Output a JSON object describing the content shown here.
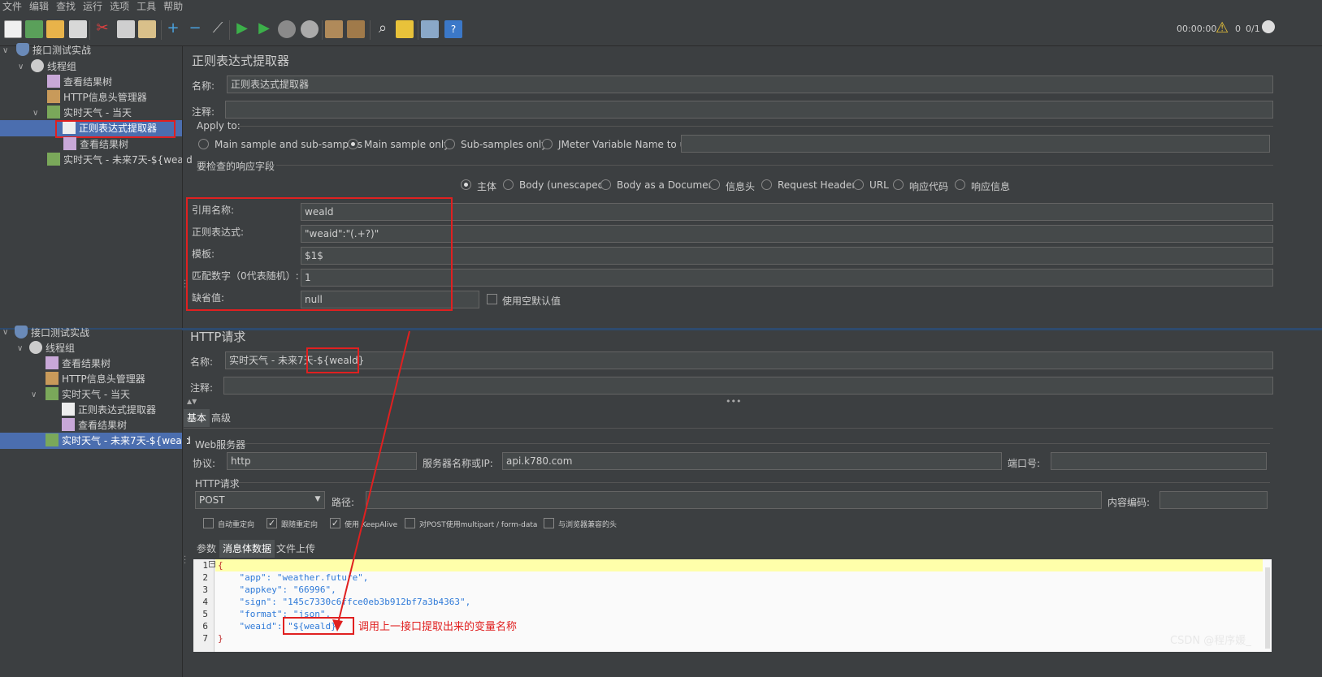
{
  "menu": [
    "文件",
    "编辑",
    "查找",
    "运行",
    "选项",
    "工具",
    "帮助"
  ],
  "status": {
    "time": "00:00:00",
    "warnings": "0",
    "threads": "0/1"
  },
  "tree": {
    "plan": "接口测试实战",
    "group": "线程组",
    "result_tree": "查看结果树",
    "header_mgr": "HTTP信息头管理器",
    "req_today": "实时天气 - 当天",
    "extractor": "正则表达式提取器",
    "result_tree2": "查看结果树",
    "req_7days": "实时天气 - 未来7天-${weald"
  },
  "extractor_panel": {
    "title": "正则表达式提取器",
    "name_label": "名称:",
    "name_value": "正则表达式提取器",
    "comment_label": "注释:",
    "apply_to": "Apply to:",
    "apply_options": [
      "Main sample and sub-samples",
      "Main sample only",
      "Sub-samples only",
      "JMeter Variable Name to use"
    ],
    "field_check": "要检查的响应字段",
    "field_options": [
      "主体",
      "Body (unescaped)",
      "Body as a Document",
      "信息头",
      "Request Headers",
      "URL",
      "响应代码",
      "响应信息"
    ],
    "ref_name_label": "引用名称:",
    "ref_name_value": "weald",
    "regex_label": "正则表达式:",
    "regex_value": "\"weaid\":\"(.+?)\"",
    "template_label": "模板:",
    "template_value": "$1$",
    "match_label": "匹配数字（0代表随机）:",
    "match_value": "1",
    "default_label": "缺省值:",
    "default_value": "null",
    "use_empty": "使用空默认值"
  },
  "http_panel": {
    "title": "HTTP请求",
    "name_label": "名称:",
    "name_prefix": "实时天气 - 未来7天-",
    "name_var": "${weald}",
    "comment_label": "注释:",
    "tab_basic": "基本",
    "tab_advanced": "高级",
    "web_server": "Web服务器",
    "protocol_label": "协议:",
    "protocol_value": "http",
    "server_label": "服务器名称或IP:",
    "server_value": "api.k780.com",
    "port_label": "端口号:",
    "http_req": "HTTP请求",
    "method": "POST",
    "path_label": "路径:",
    "encoding_label": "内容编码:",
    "opts": [
      "自动重定向",
      "跟随重定向",
      "使用 KeepAlive",
      "对POST使用multipart / form-data",
      "与浏览器兼容的头"
    ],
    "subtabs": [
      "参数",
      "消息体数据",
      "文件上传"
    ],
    "code": [
      "{",
      "    \"app\": \"weather.future\",",
      "    \"appkey\": \"66996\",",
      "    \"sign\": \"145c7330c6ffce0eb3b912bf7a3b4363\",",
      "    \"format\": \"json\",",
      "    \"weaid\": \"${weald}\"",
      "}"
    ],
    "annotation": "调用上一接口提取出来的变量名称"
  },
  "watermark": "CSDN @程序媛_"
}
